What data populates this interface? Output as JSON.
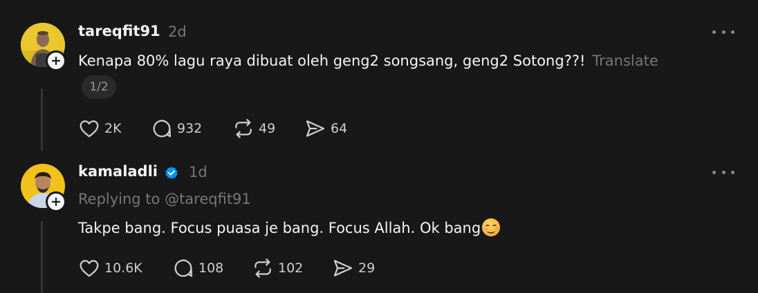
{
  "posts": [
    {
      "username": "tareqfit91",
      "time": "2d",
      "text": "Kenapa 80% lagu raya dibuat oleh geng2 songsang, geng2 Sotong??!",
      "translate": "Translate",
      "page_indicator": "1/2",
      "likes": "2K",
      "replies": "932",
      "reposts": "49",
      "shares": "64"
    },
    {
      "username": "kamaladli",
      "verified": true,
      "time": "1d",
      "replying_to": "Replying to @tareqfit91",
      "text": "Takpe bang. Focus puasa je bang. Focus Allah. Ok bang",
      "emoji": "smiling-face-icon",
      "likes": "10.6K",
      "replies": "108",
      "reposts": "102",
      "shares": "29"
    }
  ],
  "colors": {
    "background": "#181818",
    "primary_text": "#f3f5f7",
    "secondary_text": "#777777",
    "verified": "#0095f6"
  }
}
